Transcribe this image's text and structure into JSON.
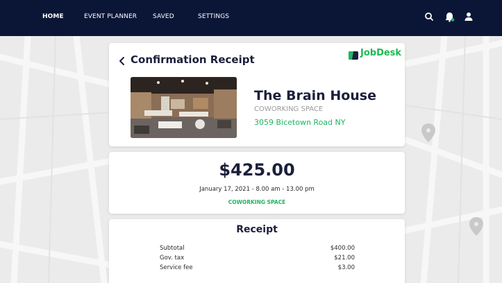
{
  "nav": {
    "items": [
      {
        "label": "HOME",
        "active": true
      },
      {
        "label": "EVENT PLANNER",
        "active": false
      },
      {
        "label": "SAVED",
        "active": false
      },
      {
        "label": "SETTINGS",
        "active": false
      }
    ],
    "icons": [
      "search-icon",
      "notification-bell-icon",
      "user-icon"
    ]
  },
  "header": {
    "title": "Confirmation Receipt",
    "brand": "JobDesk"
  },
  "venue": {
    "name": "The Brain House",
    "type": "COWORKING SPACE",
    "address": "3059 Bicetown Road NY"
  },
  "booking": {
    "price": "$425.00",
    "datetime": "January 17, 2021 - 8.00 am - 13.00 pm",
    "space_type": "COWORKING SPACE"
  },
  "receipt": {
    "title": "Receipt",
    "rows": [
      {
        "label": "Subtotal",
        "amount": "$400.00"
      },
      {
        "label": "Gov. tax",
        "amount": "$21.00"
      },
      {
        "label": "Service fee",
        "amount": "$3.00"
      }
    ]
  },
  "colors": {
    "nav_bg": "#0b1637",
    "accent_green": "#20b463",
    "title_text": "#1b1f3a",
    "map_bg": "#ebebeb"
  }
}
